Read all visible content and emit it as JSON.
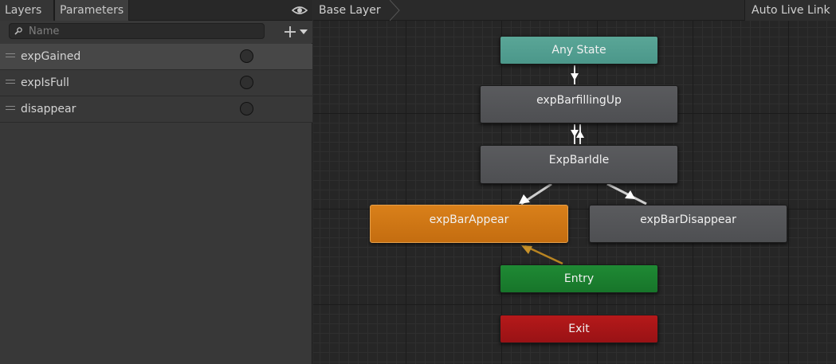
{
  "left_panel": {
    "tabs": [
      {
        "label": "Layers"
      },
      {
        "label": "Parameters"
      }
    ],
    "search": {
      "placeholder": "Name",
      "value": ""
    },
    "parameters": [
      {
        "name": "expGained"
      },
      {
        "name": "expIsFull"
      },
      {
        "name": "disappear"
      }
    ]
  },
  "graph": {
    "breadcrumb": "Base Layer",
    "auto_live_link": "Auto Live Link",
    "states": {
      "any": "Any State",
      "filling": "expBarfillingUp",
      "idle": "ExpBarIdle",
      "appear": "expBarAppear",
      "disappear": "expBarDisappear",
      "entry": "Entry",
      "exit": "Exit"
    }
  },
  "colors": {
    "any_state": "#5aa697",
    "default_state": "#d9801a",
    "entry": "#1f8a34",
    "exit": "#b5191a",
    "state": "#55565a"
  },
  "icons": {
    "visibility": "eye-icon",
    "search": "search-icon",
    "add": "plus-dropdown-icon"
  }
}
